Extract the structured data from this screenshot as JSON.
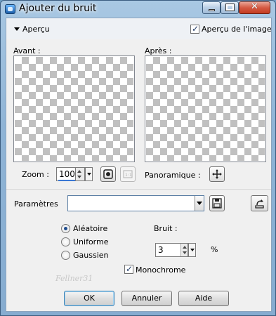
{
  "window": {
    "title": "Ajouter du bruit"
  },
  "window_controls": {
    "close_glyph": "✕"
  },
  "header": {
    "section_label": "Aperçu",
    "preview_checkbox_label": "Aperçu de l'image",
    "preview_checked": true
  },
  "previews": {
    "before_label": "Avant :",
    "after_label": "Après :"
  },
  "zoom": {
    "label": "Zoom :",
    "value": "100"
  },
  "pan": {
    "label": "Panoramique :"
  },
  "presets": {
    "label": "Paramètres",
    "value": ""
  },
  "noise_type": {
    "options": [
      {
        "label": "Aléatoire",
        "selected": true
      },
      {
        "label": "Uniforme",
        "selected": false
      },
      {
        "label": "Gaussien",
        "selected": false
      }
    ]
  },
  "noise": {
    "label": "Bruit :",
    "value": "3",
    "unit": "%"
  },
  "monochrome": {
    "label": "Monochrome",
    "checked": true
  },
  "watermark": {
    "text": "Fellner31"
  },
  "buttons": {
    "ok": "OK",
    "cancel": "Annuler",
    "help": "Aide"
  },
  "icons": {
    "app": "app-icon",
    "expand": "triangle-down-icon",
    "zoom_fit": "zoom-fit-icon",
    "zoom_actual": "actual-size-icon",
    "pan": "move-cross-icon",
    "save_preset": "save-icon",
    "reset": "reset-icon"
  }
}
